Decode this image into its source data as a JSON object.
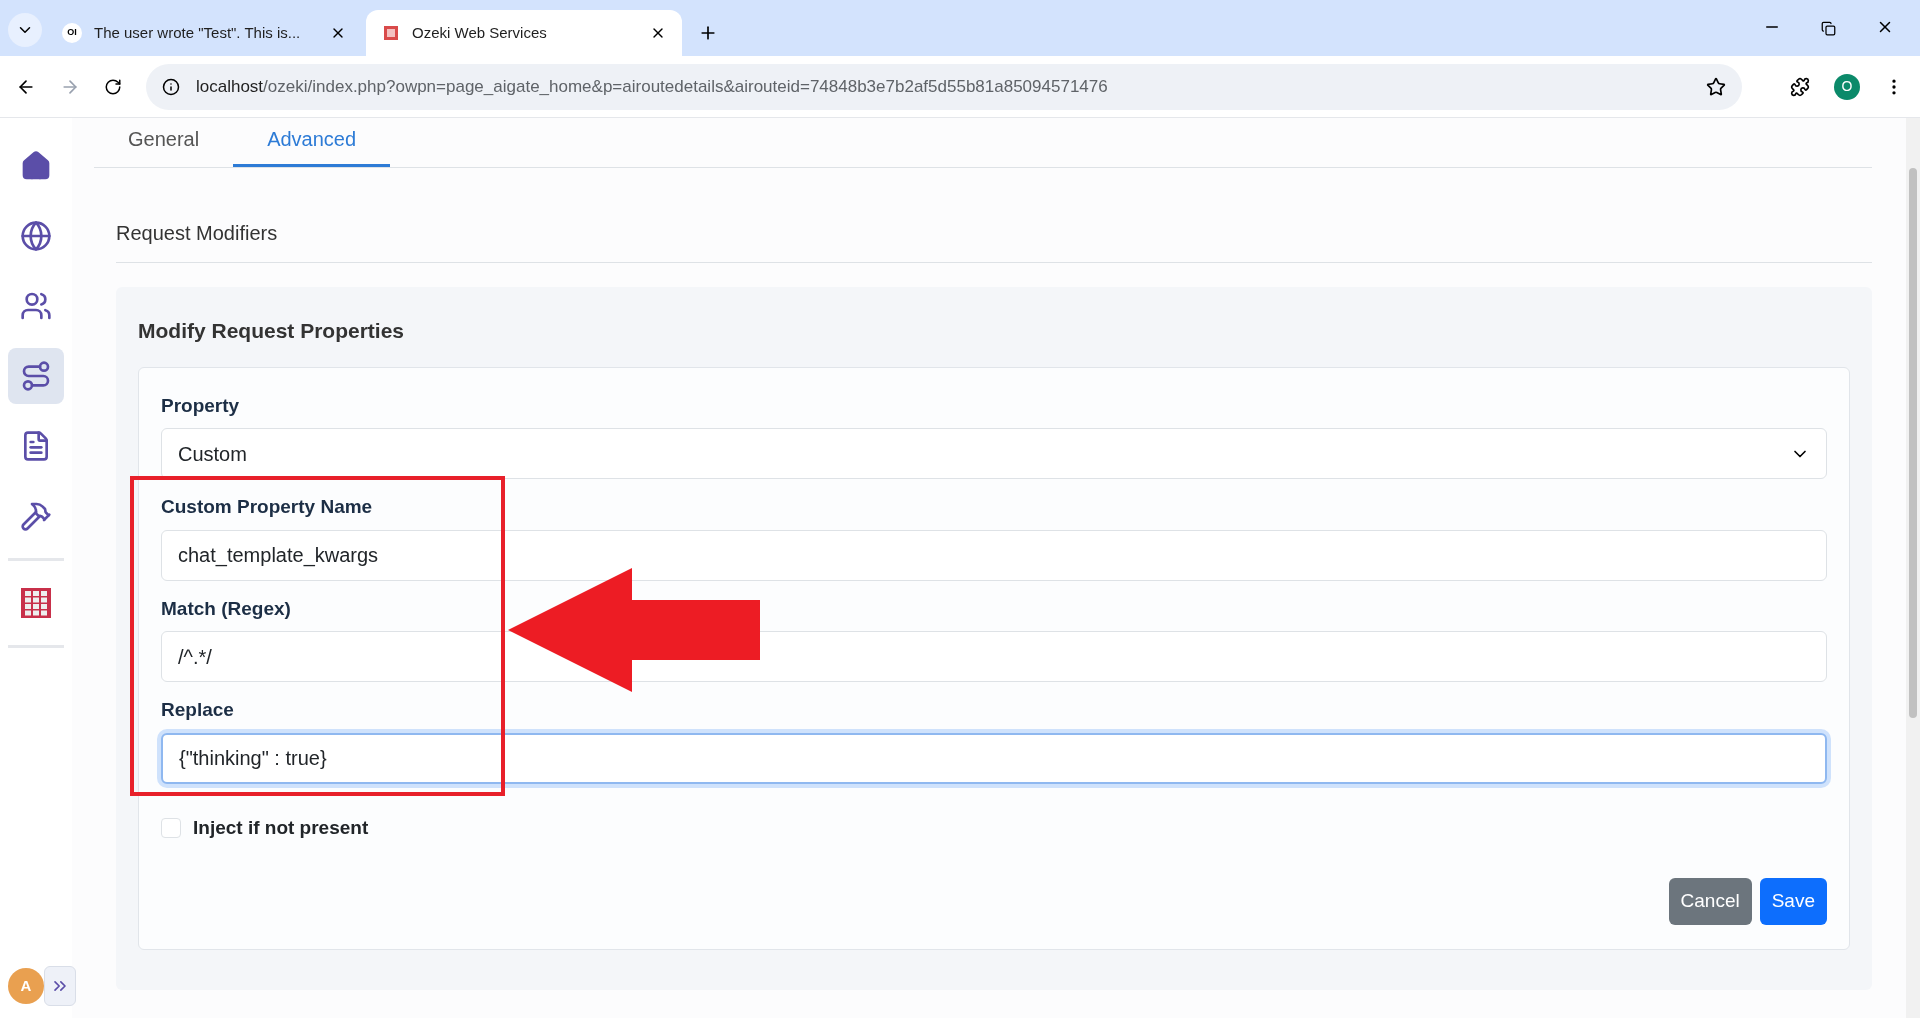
{
  "browser": {
    "tabs": [
      {
        "title": "The user wrote \"Test\". This is...",
        "badge": "OI",
        "selected": false
      },
      {
        "title": "Ozeki Web Services",
        "selected": true
      }
    ],
    "url_host": "localhost",
    "url_path": "/ozeki/index.php?owpn=page_aigate_home&p=airoutedetails&airouteid=74848b3e7b2af5d55b81a85094571476",
    "profile": "O"
  },
  "sidebar": {
    "items": [
      {
        "kind": "home",
        "selected": false
      },
      {
        "kind": "globe",
        "selected": false
      },
      {
        "kind": "users",
        "selected": false
      },
      {
        "kind": "route",
        "selected": true
      },
      {
        "kind": "document",
        "selected": false
      },
      {
        "kind": "hammer",
        "selected": false
      },
      {
        "kind": "grid",
        "selected": false
      }
    ],
    "avatar": "A"
  },
  "tabs": [
    {
      "label": "General",
      "selected": false
    },
    {
      "label": "Advanced",
      "selected": true
    }
  ],
  "section_title": "Request Modifiers",
  "card": {
    "title": "Modify Request Properties",
    "fields": [
      {
        "kind": "select",
        "label": "Property",
        "value": "Custom"
      },
      {
        "kind": "text",
        "label": "Custom Property Name",
        "value": "chat_template_kwargs",
        "focused": false
      },
      {
        "kind": "text",
        "label": "Match (Regex)",
        "value": "/^.*/",
        "focused": false
      },
      {
        "kind": "text",
        "label": "Replace",
        "value": "{\"thinking\" : true}",
        "focused": true
      }
    ],
    "checkbox": {
      "label": "Inject if not present",
      "checked": false
    },
    "buttons": [
      {
        "label": "Cancel",
        "kind": "secondary"
      },
      {
        "label": "Save",
        "kind": "primary"
      }
    ]
  }
}
